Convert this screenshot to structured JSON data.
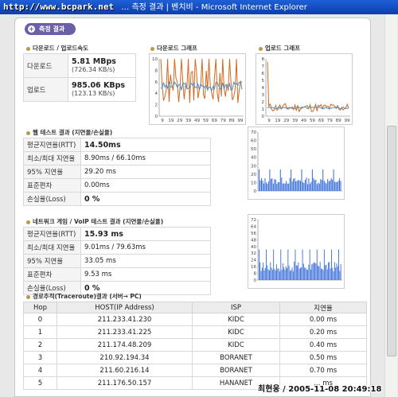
{
  "window": {
    "url": "http://www.bcpark.net",
    "title": "… 측정 결과 | 벤치비 - Microsoft Internet Explorer"
  },
  "header_label": "측정 결과",
  "speed": {
    "title": "다운로드 / 업로드속도",
    "rows": [
      {
        "label": "다운로드",
        "value": "5.81 MBps",
        "sub": "(726.34 KB/s)"
      },
      {
        "label": "업로드",
        "value": "985.06 KBps",
        "sub": "(123.13 KB/s)"
      }
    ]
  },
  "download_graph": {
    "title": "다운로드 그래프",
    "yticks": [
      "10",
      "8",
      "6",
      "4",
      "2",
      "0"
    ],
    "xticks": [
      "9",
      "19",
      "29",
      "39",
      "49",
      "59",
      "69",
      "79",
      "89",
      "99"
    ]
  },
  "upload_graph": {
    "title": "업로드 그래프",
    "yticks": [
      "8",
      "7",
      "6",
      "5",
      "4",
      "3",
      "2",
      "1",
      "0"
    ],
    "xticks": [
      "9",
      "19",
      "29",
      "39",
      "49",
      "59",
      "69",
      "79",
      "89",
      "99"
    ]
  },
  "web_test": {
    "title": "웹 테스트 결과 (지연율/손실율)",
    "rows": [
      {
        "label": "평균지연율(RTT)",
        "value": "14.50ms"
      },
      {
        "label": "최소/최대 지연율",
        "value": "8.90ms / 66.10ms"
      },
      {
        "label": "95% 지연율",
        "value": "29.20 ms"
      },
      {
        "label": "표준편차",
        "value": "0.00ms"
      },
      {
        "label": "손실율(Loss)",
        "value": "0 %"
      }
    ],
    "graph_yticks": [
      "70",
      "60",
      "50",
      "40",
      "30",
      "20",
      "10",
      "0"
    ]
  },
  "game_test": {
    "title": "네트워크 게임 / VoIP 테스트 결과 (지연율/손실율)",
    "rows": [
      {
        "label": "평균지연율(RTT)",
        "value": "15.93 ms"
      },
      {
        "label": "최소/최대 지연율",
        "value": "9.01ms / 79.63ms"
      },
      {
        "label": "95% 지연율",
        "value": "33.05 ms"
      },
      {
        "label": "표준편차",
        "value": "9.53 ms"
      },
      {
        "label": "손실율(Loss)",
        "value": "0 %"
      }
    ],
    "graph_yticks": [
      "72",
      "64",
      "56",
      "48",
      "40",
      "32",
      "24",
      "16",
      "8",
      "0"
    ]
  },
  "traceroute": {
    "title": "경로추적(Traceroute)결과 (서버→ PC)",
    "columns": [
      "Hop",
      "HOST(IP Address)",
      "ISP",
      "지연율"
    ],
    "rows": [
      [
        "0",
        "211.233.41.230",
        "KIDC",
        "0.00 ms"
      ],
      [
        "1",
        "211.233.41.225",
        "KIDC",
        "0.20 ms"
      ],
      [
        "2",
        "211.174.48.209",
        "KIDC",
        "0.40 ms"
      ],
      [
        "3",
        "210.92.194.34",
        "BORANET",
        "0.50 ms"
      ],
      [
        "4",
        "211.60.216.14",
        "BORANET",
        "0.70 ms"
      ],
      [
        "5",
        "211.176.50.157",
        "HANANET",
        "… ms"
      ]
    ]
  },
  "watermark": "최현웅 / 2005-11-08 20:49:18"
}
